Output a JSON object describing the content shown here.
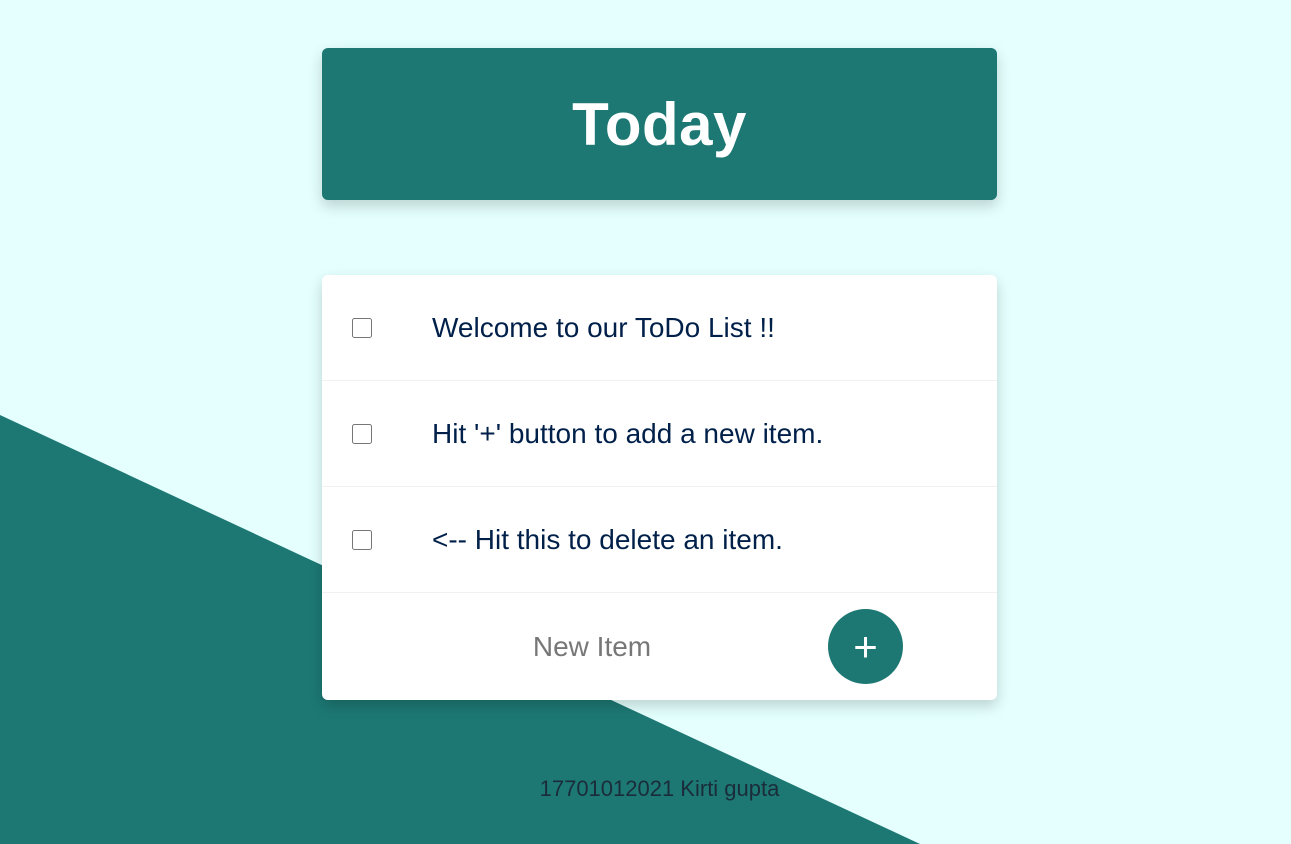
{
  "colors": {
    "background": "#E4FFFE",
    "accent": "#1D7874",
    "text": "#00204A",
    "card": "#FFFFFF"
  },
  "heading": {
    "title": "Today"
  },
  "items": [
    {
      "text": "Welcome to our ToDo List !!",
      "checked": false
    },
    {
      "text": "Hit '+' button to add a new item.",
      "checked": false
    },
    {
      "text": "<-- Hit this to delete an item.",
      "checked": false
    }
  ],
  "new_item": {
    "placeholder": "New Item",
    "value": "",
    "add_label": "+"
  },
  "footer": {
    "text": "17701012021 Kirti gupta"
  }
}
